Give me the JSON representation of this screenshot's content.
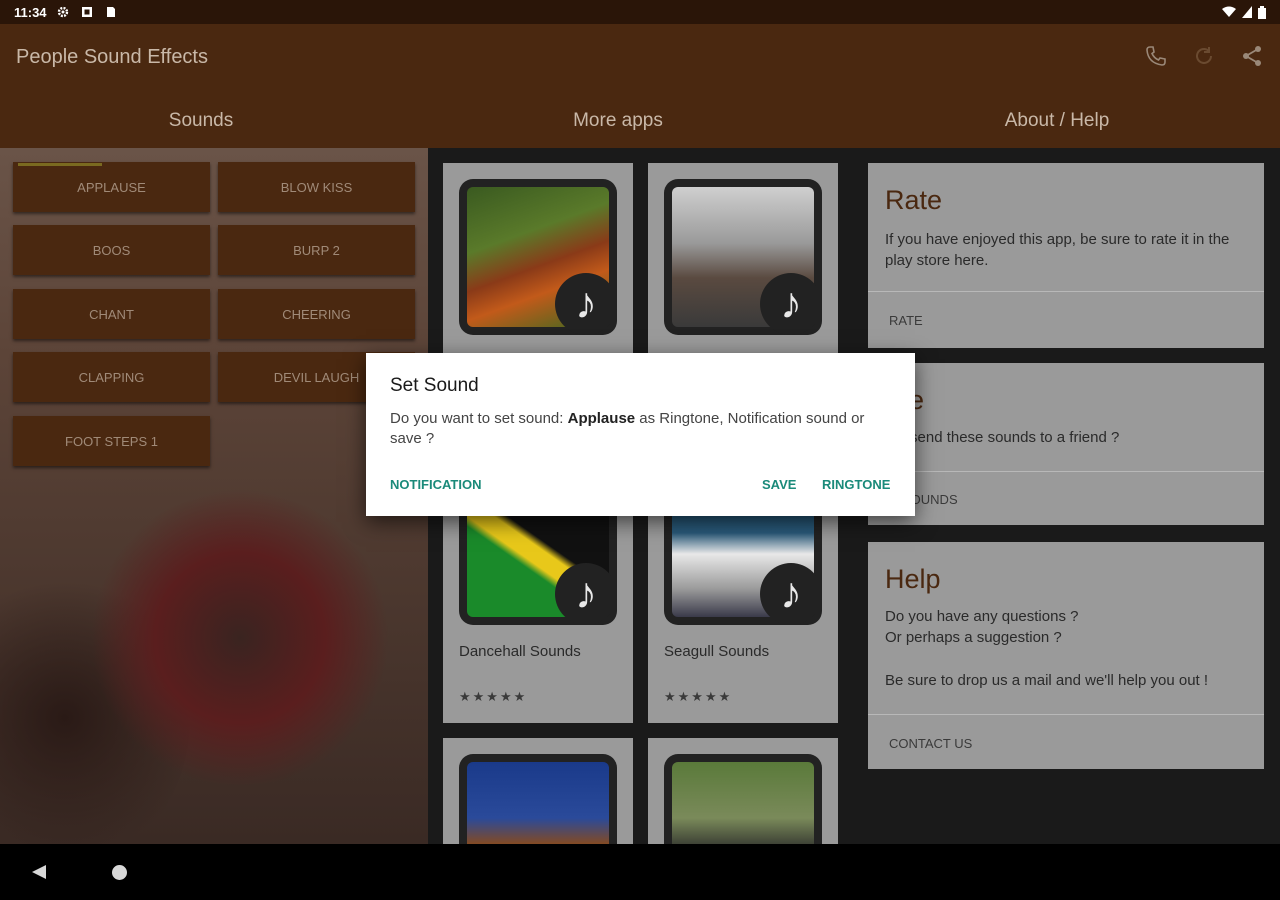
{
  "status_bar": {
    "time": "11:34",
    "icons": [
      "gear-icon",
      "square-icon",
      "sim-icon"
    ],
    "right_icons": [
      "wifi-icon",
      "signal-icon",
      "battery-icon"
    ]
  },
  "app_bar": {
    "title": "People Sound Effects",
    "actions": [
      "phone-icon",
      "refresh-icon",
      "share-icon"
    ]
  },
  "tabs": [
    {
      "label": "Sounds"
    },
    {
      "label": "More apps"
    },
    {
      "label": "About / Help"
    }
  ],
  "sounds": [
    {
      "label": "APPLAUSE"
    },
    {
      "label": "BLOW KISS"
    },
    {
      "label": "BOOS"
    },
    {
      "label": "BURP 2"
    },
    {
      "label": "CHANT"
    },
    {
      "label": "CHEERING"
    },
    {
      "label": "CLAPPING"
    },
    {
      "label": "DEVIL LAUGH"
    },
    {
      "label": "FOOT STEPS 1"
    }
  ],
  "more_apps": [
    {
      "name": "",
      "stars": "",
      "image": "rooster"
    },
    {
      "name": "",
      "stars": "",
      "image": "deer"
    },
    {
      "name": "Dancehall Sounds",
      "stars": "★★★★★",
      "image": "jamaica-flag"
    },
    {
      "name": "Seagull Sounds",
      "stars": "★★★★★",
      "image": "seagull"
    },
    {
      "name": "",
      "stars": "",
      "image": "horse"
    },
    {
      "name": "",
      "stars": "",
      "image": "buffalo"
    }
  ],
  "about": {
    "rate": {
      "title": "Rate",
      "body": "If you have enjoyed this app, be sure to rate it in the play store here.",
      "action": "RATE"
    },
    "share": {
      "title": "are",
      "body": "t to send these sounds to a friend ?",
      "action": "D SOUNDS"
    },
    "help": {
      "title": "Help",
      "line1": "Do you have any questions ?",
      "line2": "Or perhaps a suggestion ?",
      "line3": "Be sure to drop us a mail and we'll help you out !",
      "action": "CONTACT US"
    }
  },
  "dialog": {
    "title": "Set Sound",
    "message_prefix": "Do you want to set sound: ",
    "sound_name": "Applause",
    "message_suffix": " as Ringtone, Notification sound or save ?",
    "buttons": {
      "notification": "NOTIFICATION",
      "save": "SAVE",
      "ringtone": "RINGTONE"
    },
    "accent_color": "#1a8a7a"
  },
  "colors": {
    "app_bar": "#4a2810",
    "status_bar": "#2a1508",
    "card": "#9a9a9a",
    "heading": "#4a2810"
  }
}
